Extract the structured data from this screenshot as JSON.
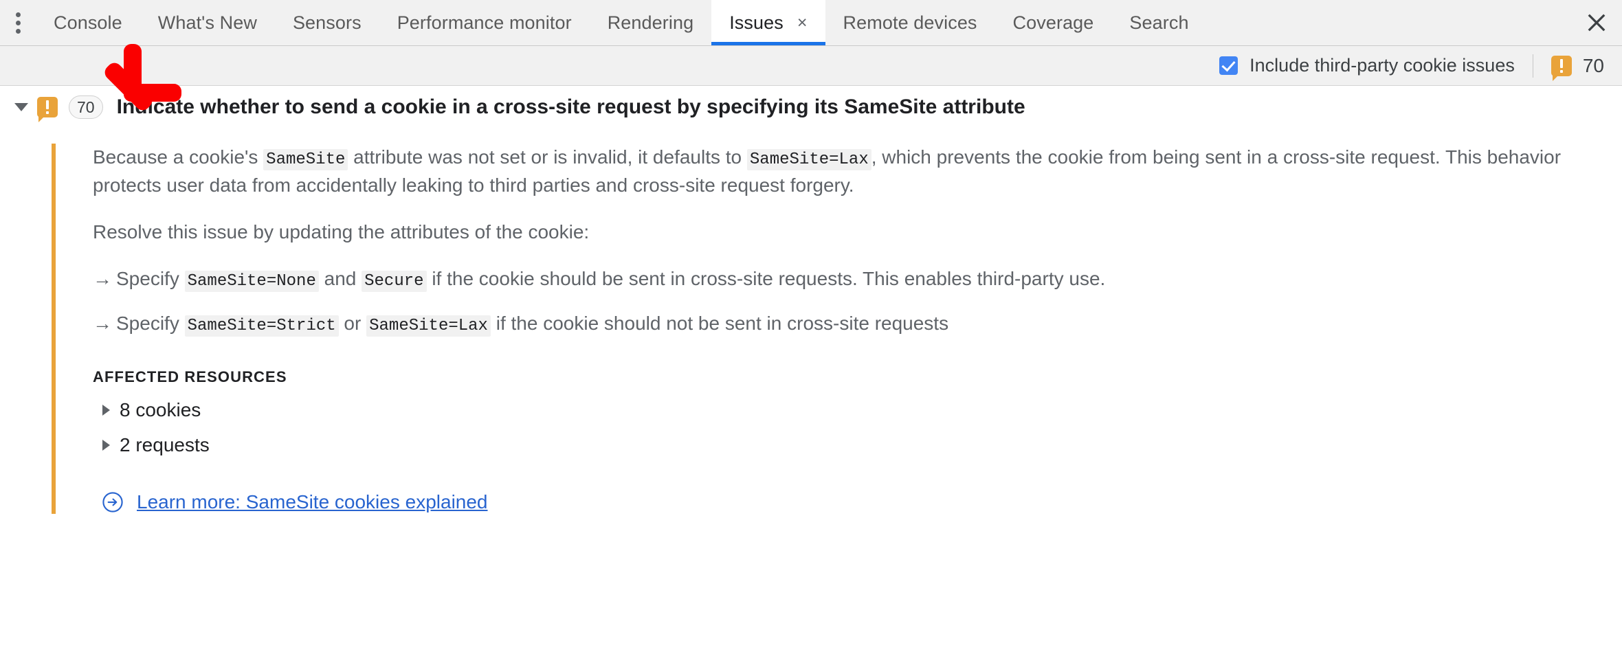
{
  "drawer": {
    "menu_icon": "kebab-menu-icon",
    "close_icon": "close-icon",
    "tabs": [
      {
        "label": "Console",
        "selected": false,
        "closable": false
      },
      {
        "label": "What's New",
        "selected": false,
        "closable": false
      },
      {
        "label": "Sensors",
        "selected": false,
        "closable": false
      },
      {
        "label": "Performance monitor",
        "selected": false,
        "closable": false
      },
      {
        "label": "Rendering",
        "selected": false,
        "closable": false
      },
      {
        "label": "Issues",
        "selected": true,
        "closable": true,
        "close_label": "×"
      },
      {
        "label": "Remote devices",
        "selected": false,
        "closable": false
      },
      {
        "label": "Coverage",
        "selected": false,
        "closable": false
      },
      {
        "label": "Search",
        "selected": false,
        "closable": false
      }
    ]
  },
  "toolbar": {
    "third_party_checkbox_label": "Include third-party cookie issues",
    "third_party_checked": true,
    "warning_icon": "warning-issue-icon",
    "warning_count": "70"
  },
  "issue": {
    "expanded": true,
    "twisty_icon": "chevron-down-icon",
    "severity_icon": "warning-issue-icon",
    "count_badge": "70",
    "title": "Indicate whether to send a cookie in a cross-site request by specifying its SameSite attribute",
    "description": {
      "part1": "Because a cookie's ",
      "code1": "SameSite",
      "part2": " attribute was not set or is invalid, it defaults to ",
      "code2": "SameSite=Lax",
      "part3": ", which prevents the cookie from being sent in a cross-site request. This behavior protects user data from accidentally leaking to third parties and cross-site request forgery."
    },
    "resolve_intro": "Resolve this issue by updating the attributes of the cookie:",
    "recommendations": [
      {
        "bullet": "→",
        "part1": "Specify ",
        "code1": "SameSite=None",
        "part2": " and ",
        "code2": "Secure",
        "part3": " if the cookie should be sent in cross-site requests. This enables third-party use."
      },
      {
        "bullet": "→",
        "part1": "Specify ",
        "code1": "SameSite=Strict",
        "part2": " or ",
        "code2": "SameSite=Lax",
        "part3": " if the cookie should not be sent in cross-site requests"
      }
    ],
    "affected_resources_title": "AFFECTED RESOURCES",
    "affected_resources": [
      {
        "label": "8 cookies",
        "expand_icon": "chevron-right-icon"
      },
      {
        "label": "2 requests",
        "expand_icon": "chevron-right-icon"
      }
    ],
    "learn_more": {
      "icon": "circled-arrow-right-icon",
      "label": "Learn more: SameSite cookies explained"
    }
  },
  "annotation": {
    "arrow_icon": "red-arrow-down-left-icon",
    "color": "#fa0000"
  },
  "colors": {
    "accent_blue": "#1a73e8",
    "warning_orange": "#e9a33a",
    "link_blue": "#2864cf",
    "toolbar_bg": "#f1f1f1"
  }
}
